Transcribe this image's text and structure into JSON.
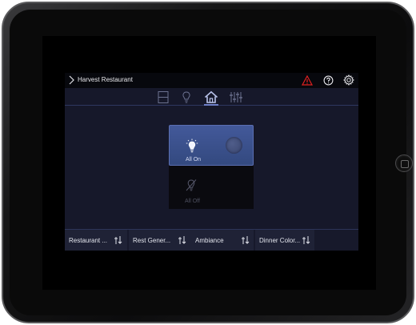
{
  "header": {
    "title": "Harvest Restaurant",
    "icons": [
      "chevron-right-icon",
      "warning-icon",
      "help-icon",
      "gear-icon"
    ],
    "warning_color": "#e02020"
  },
  "tabs": [
    {
      "name": "rooms-tab",
      "icon": "panel-icon",
      "active": false
    },
    {
      "name": "lighting-tab",
      "icon": "bulb-icon",
      "active": false
    },
    {
      "name": "home-tab",
      "icon": "home-icon",
      "active": true
    },
    {
      "name": "controls-tab",
      "icon": "sliders-icon",
      "active": false
    }
  ],
  "lighting": {
    "all_on_label": "All On",
    "all_off_label": "All Off",
    "all_on_active": true
  },
  "scenes": [
    {
      "label": "Restaurant ..."
    },
    {
      "label": "Rest Gener..."
    },
    {
      "label": "Ambiance"
    },
    {
      "label": "Dinner Color..."
    }
  ],
  "colors": {
    "accent": "#3f5593",
    "background": "#16182a",
    "topbar": "#07080d"
  }
}
